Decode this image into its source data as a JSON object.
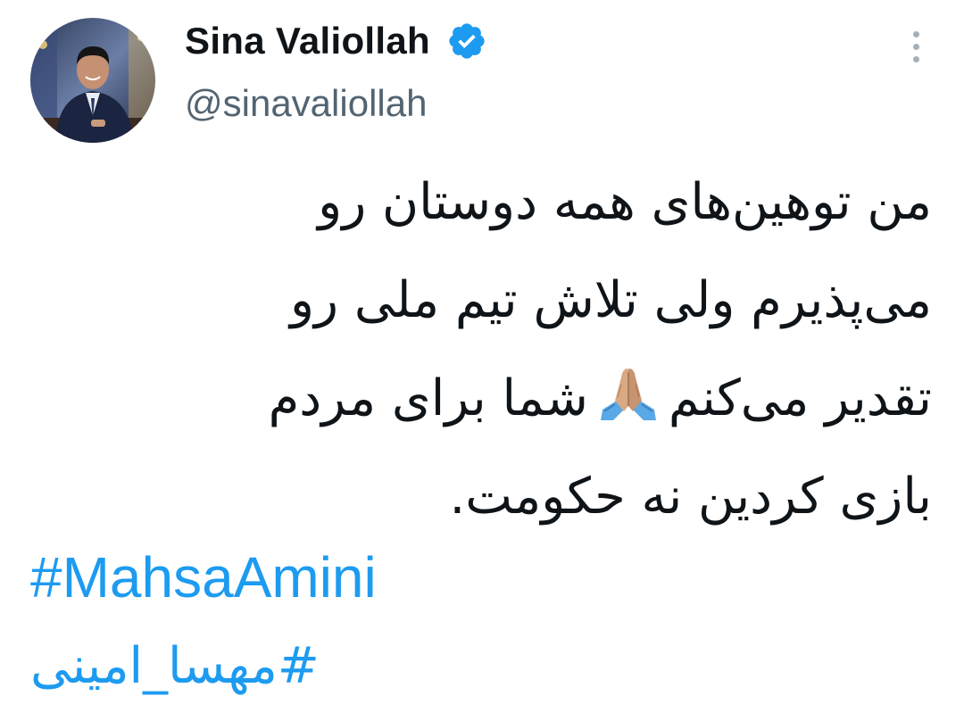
{
  "author": {
    "display_name": "Sina Valiollah",
    "handle": "@sinavaliollah",
    "verified_icon": "verified-badge-icon",
    "avatar_alt": "profile photo"
  },
  "more_icon": "more-vertical-icon",
  "tweet": {
    "lines": [
      "من توهین‌های همه دوستان رو",
      "می‌پذیرم ولی تلاش تیم ملی رو",
      {
        "before": "تقدیر می‌کنم",
        "emoji": "folded-hands-icon",
        "after": "شما برای مردم"
      },
      "بازی کردین نه حکومت."
    ],
    "hashtags": [
      "#MahsaAmini",
      "#مهسا_امینی"
    ]
  },
  "colors": {
    "link": "#1d9bf0",
    "text": "#0f1419",
    "secondary": "#536471",
    "verified": "#1d9bf0"
  }
}
